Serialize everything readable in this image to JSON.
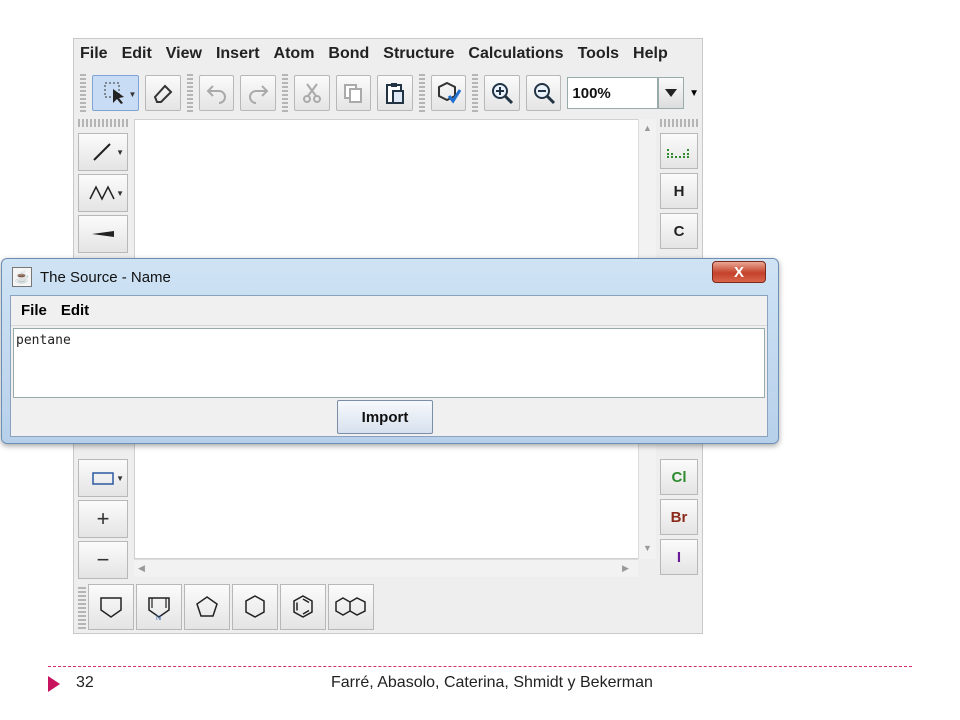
{
  "editor": {
    "menu": [
      {
        "label": "File"
      },
      {
        "label": "Edit"
      },
      {
        "label": "View"
      },
      {
        "label": "Insert"
      },
      {
        "label": "Atom"
      },
      {
        "label": "Bond"
      },
      {
        "label": "Structure"
      },
      {
        "label": "Calculations"
      },
      {
        "label": "Tools"
      },
      {
        "label": "Help"
      }
    ],
    "zoom": "100%",
    "right_tools": [
      {
        "label": "",
        "color": "#2e8b2e"
      },
      {
        "label": "H",
        "color": "#222222"
      },
      {
        "label": "C",
        "color": "#222222"
      },
      {
        "label": "Cl",
        "color": "#2e8b2e"
      },
      {
        "label": "Br",
        "color": "#8b2a1a"
      },
      {
        "label": "I",
        "color": "#6a1b9a"
      }
    ],
    "left_tool_symbols": [
      "+",
      "−"
    ]
  },
  "dialog": {
    "title": "The Source - Name",
    "close_label": "X",
    "menu": [
      {
        "label": "File"
      },
      {
        "label": "Edit"
      }
    ],
    "text_value": "pentane",
    "import_label": "Import"
  },
  "footer": {
    "page_number": "32",
    "authors": "Farré, Abasolo, Caterina, Shmidt y Bekerman",
    "accent_color": "#c8135e"
  }
}
